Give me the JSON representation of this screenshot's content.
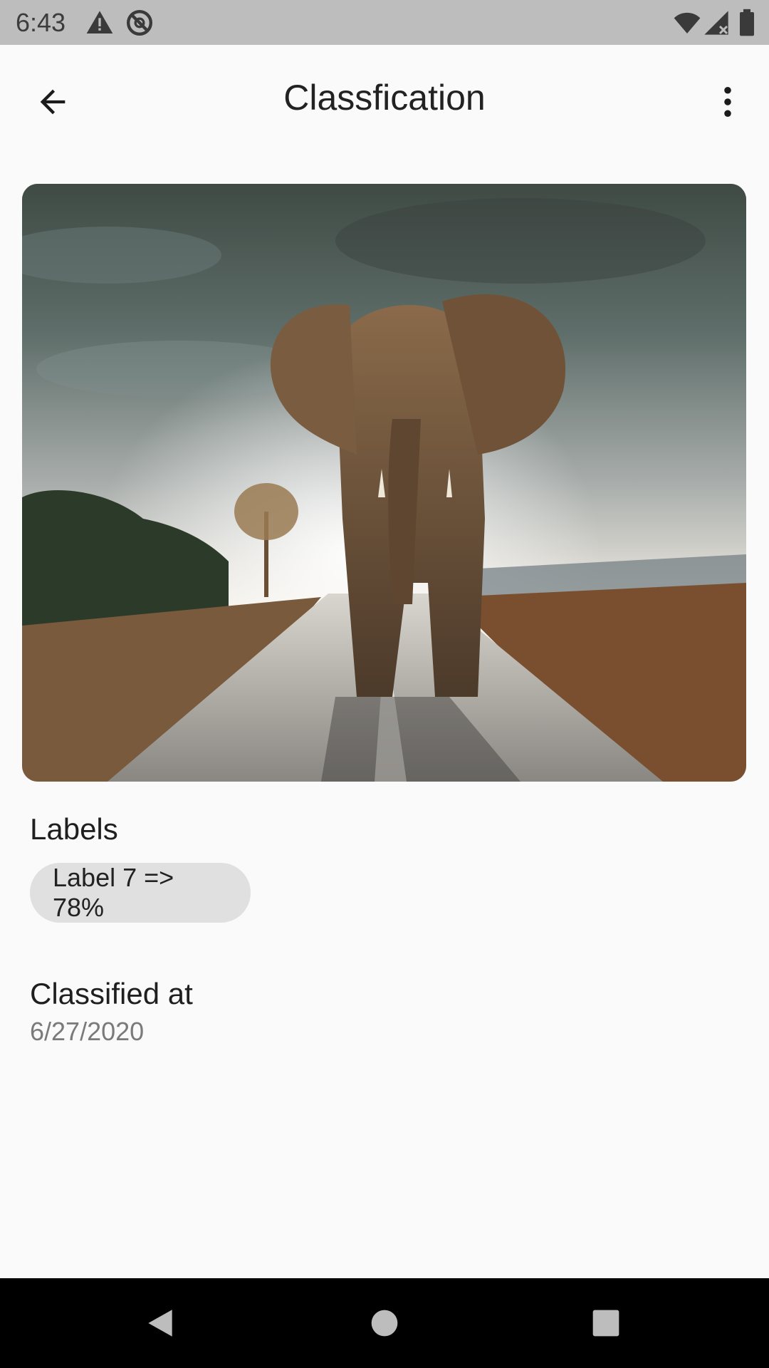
{
  "status_bar": {
    "time": "6:43",
    "icons": [
      "warning-icon",
      "no-sync-icon",
      "wifi-icon",
      "signal-icon",
      "battery-icon"
    ]
  },
  "app_bar": {
    "title": "Classfication",
    "back_icon": "arrow-back-icon",
    "menu_icon": "more-vert-icon"
  },
  "image": {
    "subject": "elephant"
  },
  "labels": {
    "heading": "Labels",
    "chips": [
      "Label 7 => 78%"
    ]
  },
  "classified": {
    "heading": "Classified at",
    "date": "6/27/2020"
  },
  "nav_bar": {
    "icons": [
      "nav-back-icon",
      "nav-home-icon",
      "nav-recents-icon"
    ]
  },
  "colors": {
    "background": "#fafafa",
    "status_bar": "#bdbdbd",
    "chip": "#e0e0e0",
    "nav_bar": "#000000"
  }
}
